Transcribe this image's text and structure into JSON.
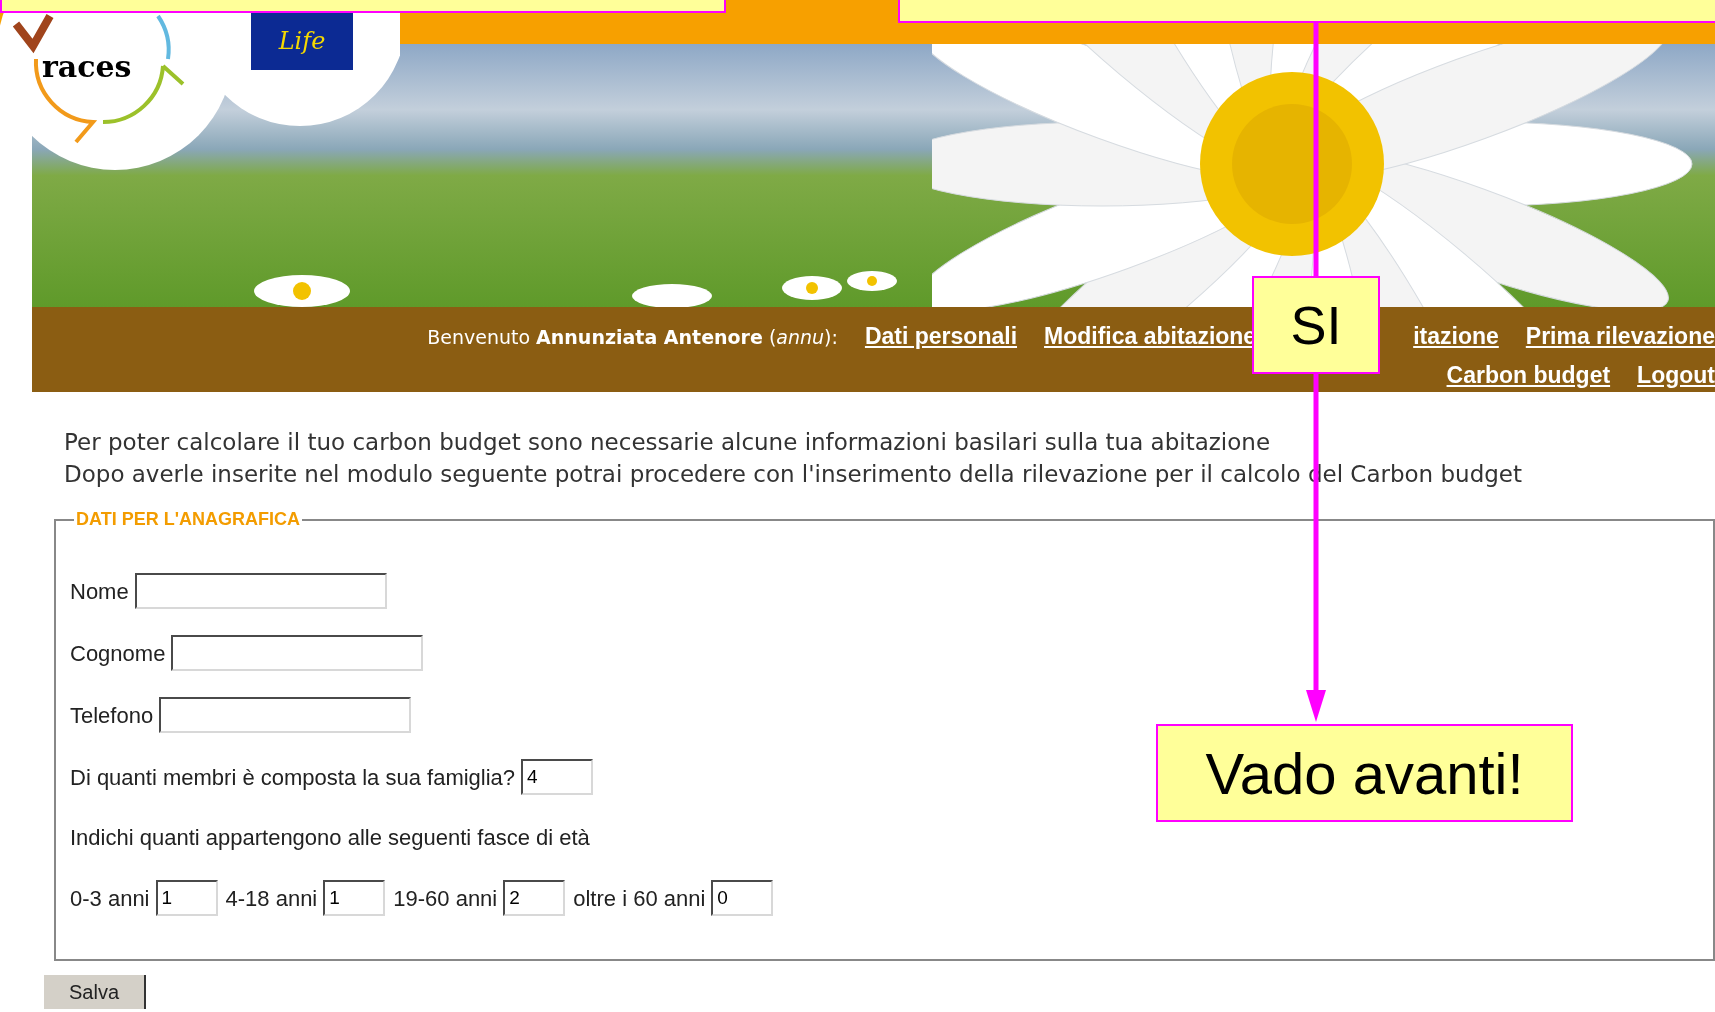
{
  "header": {
    "logo_text": "races",
    "eu_logo_text": "Life"
  },
  "nav": {
    "welcome": "Benvenuto **Annunziata Antenore** (*annu*):",
    "links_row_1": [
      "Dati personali",
      "Modifica abitazione",
      "itazione",
      "Prima rilevazione"
    ],
    "links_row_2": [
      "Carbon budget",
      "Logout"
    ]
  },
  "intro": [
    "Per poter calcolare il tuo carbon budget sono necessarie alcune informazioni basilari sulla tua abitazione",
    "Dopo averle inserite nel modulo seguente potrai procedere con l'inserimento della rilevazione per il calcolo del Carbon budget"
  ],
  "form": {
    "legend": "DATI PER L'ANAGRAFICA",
    "fields": [
      {
        "label": "Nome"
      },
      {
        "label": "Cognome"
      },
      {
        "label": "Telefono"
      }
    ],
    "family": {
      "label": "Di quanti membri è composta la sua famiglia?",
      "value": "4"
    },
    "age_prompt": "Indichi quanti appartengono alle seguenti fasce di età",
    "age_groups": [
      {
        "label": "0-3 anni",
        "value": "1"
      },
      {
        "label": "4-18 anni",
        "value": "1"
      },
      {
        "label": "19-60 anni",
        "value": "2"
      },
      {
        "label": "oltre i 60 anni",
        "value": "0"
      }
    ],
    "submit": "Salva"
  },
  "callouts": [
    {
      "text": "SI"
    },
    {
      "text": "Vado avanti!"
    }
  ]
}
